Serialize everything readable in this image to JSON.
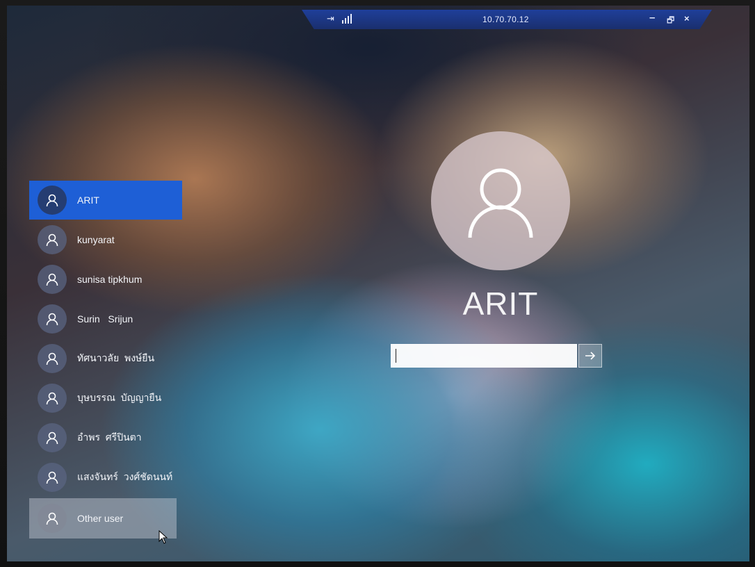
{
  "connection_bar": {
    "title": "10.70.70.12",
    "pin_glyph": "⇥",
    "minimize_glyph": "–",
    "restore_glyph": "🗗",
    "close_glyph": "×"
  },
  "users": [
    {
      "name": "ARIT",
      "selected": true
    },
    {
      "name": "kunyarat"
    },
    {
      "name": "sunisa tipkhum"
    },
    {
      "name": "Surin   Srijun"
    },
    {
      "name": "ทัศนาวลัย  พงษ์ยืน"
    },
    {
      "name": "บุษบรรณ  บัญญายืน"
    },
    {
      "name": "อำพร  ศรีปินตา"
    },
    {
      "name": "แสงจันทร์  วงศ์ชัดนนท์"
    },
    {
      "name": "Other user",
      "other": true
    }
  ],
  "main": {
    "username": "ARIT",
    "password_placeholder": "",
    "submit_glyph": "→"
  },
  "colors": {
    "selected_user_bg": "#1e5fd6",
    "connection_bar_bg": "#1f3f9a"
  },
  "icons": {
    "user_avatar": "user-icon",
    "submit": "arrow-right-icon",
    "pin": "pin-icon",
    "signal": "signal-icon"
  }
}
